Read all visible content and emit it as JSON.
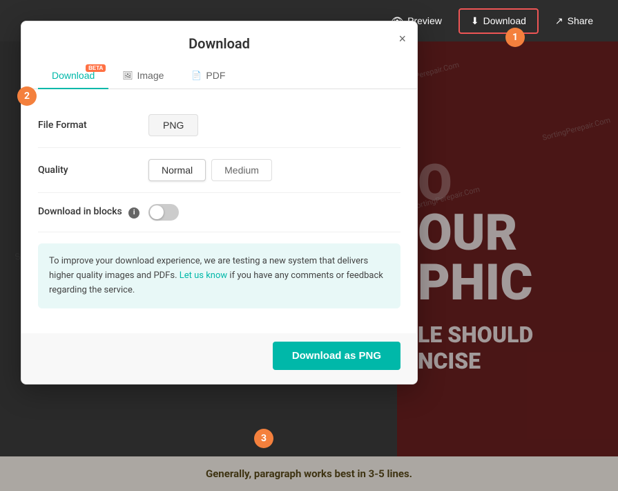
{
  "toolbar": {
    "preview_label": "Preview",
    "download_label": "Download",
    "share_label": "Share"
  },
  "dialog": {
    "title": "Download",
    "close_label": "×",
    "tabs": [
      {
        "id": "download",
        "label": "Download",
        "active": true,
        "beta": true
      },
      {
        "id": "image",
        "label": "Image",
        "active": false,
        "beta": false
      },
      {
        "id": "pdf",
        "label": "PDF",
        "active": false,
        "beta": false
      }
    ],
    "fields": {
      "file_format": {
        "label": "File Format",
        "value": "PNG"
      },
      "quality": {
        "label": "Quality",
        "options": [
          "Normal",
          "Medium"
        ],
        "selected": "Normal"
      },
      "download_in_blocks": {
        "label": "Download in blocks",
        "enabled": false
      }
    },
    "info_text": {
      "prefix": "To improve your download experience, we are testing a new system that delivers higher quality images and PDFs.",
      "link_text": "Let us know",
      "suffix": "if you have any comments or feedback regarding the service."
    },
    "download_button": "Download as PNG"
  },
  "design": {
    "words": [
      "O",
      "OUR",
      "PHIC"
    ],
    "subtitle": "LE SHOULD",
    "subtitle2": "NCISE",
    "bottom_text": "Generally, paragraph works best in 3-5 lines."
  },
  "steps": {
    "badge1": "1",
    "badge2": "2",
    "badge3": "3"
  },
  "watermarks": [
    "SortingPerepair.Com",
    "SortingPerepair.Com",
    "SortingPerepair.Com"
  ]
}
